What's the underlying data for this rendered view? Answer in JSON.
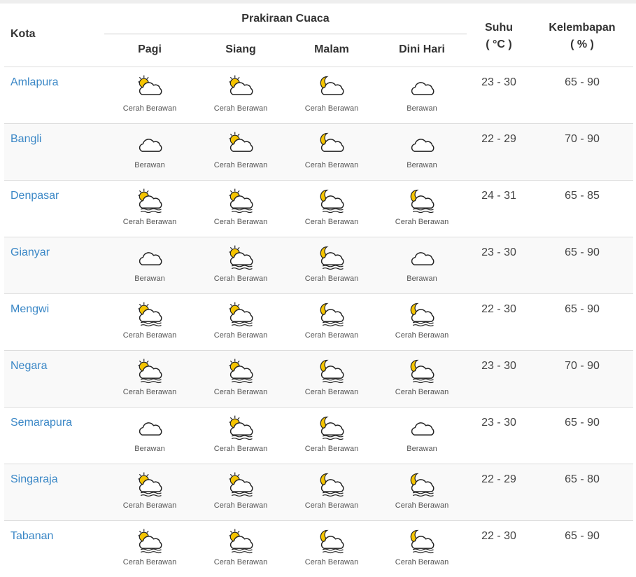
{
  "header": {
    "kota": "Kota",
    "prakiraan": "Prakiraan Cuaca",
    "periods": [
      "Pagi",
      "Siang",
      "Malam",
      "Dini Hari"
    ],
    "suhu": "Suhu",
    "suhu_unit": "( °C )",
    "kelembapan": "Kelembapan",
    "kelembapan_unit": "( % )"
  },
  "colors": {
    "link": "#3a87c6",
    "sun_moon": "#f5c400",
    "stripe": "#f9f9f9"
  },
  "rows": [
    {
      "city": "Amlapura",
      "temp": "23 - 30",
      "hum": "65 - 90",
      "forecast": [
        {
          "icon": "sun-cloud-icon",
          "label": "Cerah Berawan"
        },
        {
          "icon": "sun-cloud-icon",
          "label": "Cerah Berawan"
        },
        {
          "icon": "moon-cloud-icon",
          "label": "Cerah Berawan"
        },
        {
          "icon": "cloud-icon",
          "label": "Berawan"
        }
      ]
    },
    {
      "city": "Bangli",
      "temp": "22 - 29",
      "hum": "70 - 90",
      "forecast": [
        {
          "icon": "cloud-icon",
          "label": "Berawan"
        },
        {
          "icon": "sun-cloud-icon",
          "label": "Cerah Berawan"
        },
        {
          "icon": "moon-cloud-icon",
          "label": "Cerah Berawan"
        },
        {
          "icon": "cloud-icon",
          "label": "Berawan"
        }
      ]
    },
    {
      "city": "Denpasar",
      "temp": "24 - 31",
      "hum": "65 - 85",
      "forecast": [
        {
          "icon": "sun-cloud-haze-icon",
          "label": "Cerah Berawan"
        },
        {
          "icon": "sun-cloud-haze-icon",
          "label": "Cerah Berawan"
        },
        {
          "icon": "moon-cloud-haze-icon",
          "label": "Cerah Berawan"
        },
        {
          "icon": "moon-cloud-haze-icon",
          "label": "Cerah Berawan"
        }
      ]
    },
    {
      "city": "Gianyar",
      "temp": "23 - 30",
      "hum": "65 - 90",
      "forecast": [
        {
          "icon": "cloud-icon",
          "label": "Berawan"
        },
        {
          "icon": "sun-cloud-haze-icon",
          "label": "Cerah Berawan"
        },
        {
          "icon": "moon-cloud-haze-icon",
          "label": "Cerah Berawan"
        },
        {
          "icon": "cloud-icon",
          "label": "Berawan"
        }
      ]
    },
    {
      "city": "Mengwi",
      "temp": "22 - 30",
      "hum": "65 - 90",
      "forecast": [
        {
          "icon": "sun-cloud-haze-icon",
          "label": "Cerah Berawan"
        },
        {
          "icon": "sun-cloud-haze-icon",
          "label": "Cerah Berawan"
        },
        {
          "icon": "moon-cloud-haze-icon",
          "label": "Cerah Berawan"
        },
        {
          "icon": "moon-cloud-haze-icon",
          "label": "Cerah Berawan"
        }
      ]
    },
    {
      "city": "Negara",
      "temp": "23 - 30",
      "hum": "70 - 90",
      "forecast": [
        {
          "icon": "sun-cloud-haze-icon",
          "label": "Cerah Berawan"
        },
        {
          "icon": "sun-cloud-haze-icon",
          "label": "Cerah Berawan"
        },
        {
          "icon": "moon-cloud-haze-icon",
          "label": "Cerah Berawan"
        },
        {
          "icon": "moon-cloud-haze-icon",
          "label": "Cerah Berawan"
        }
      ]
    },
    {
      "city": "Semarapura",
      "temp": "23 - 30",
      "hum": "65 - 90",
      "forecast": [
        {
          "icon": "cloud-icon",
          "label": "Berawan"
        },
        {
          "icon": "sun-cloud-haze-icon",
          "label": "Cerah Berawan"
        },
        {
          "icon": "moon-cloud-haze-icon",
          "label": "Cerah Berawan"
        },
        {
          "icon": "cloud-icon",
          "label": "Berawan"
        }
      ]
    },
    {
      "city": "Singaraja",
      "temp": "22 - 29",
      "hum": "65 - 80",
      "forecast": [
        {
          "icon": "sun-cloud-haze-icon",
          "label": "Cerah Berawan"
        },
        {
          "icon": "sun-cloud-haze-icon",
          "label": "Cerah Berawan"
        },
        {
          "icon": "moon-cloud-haze-icon",
          "label": "Cerah Berawan"
        },
        {
          "icon": "moon-cloud-haze-icon",
          "label": "Cerah Berawan"
        }
      ]
    },
    {
      "city": "Tabanan",
      "temp": "22 - 30",
      "hum": "65 - 90",
      "forecast": [
        {
          "icon": "sun-cloud-haze-icon",
          "label": "Cerah Berawan"
        },
        {
          "icon": "sun-cloud-haze-icon",
          "label": "Cerah Berawan"
        },
        {
          "icon": "moon-cloud-haze-icon",
          "label": "Cerah Berawan"
        },
        {
          "icon": "moon-cloud-haze-icon",
          "label": "Cerah Berawan"
        }
      ]
    }
  ]
}
